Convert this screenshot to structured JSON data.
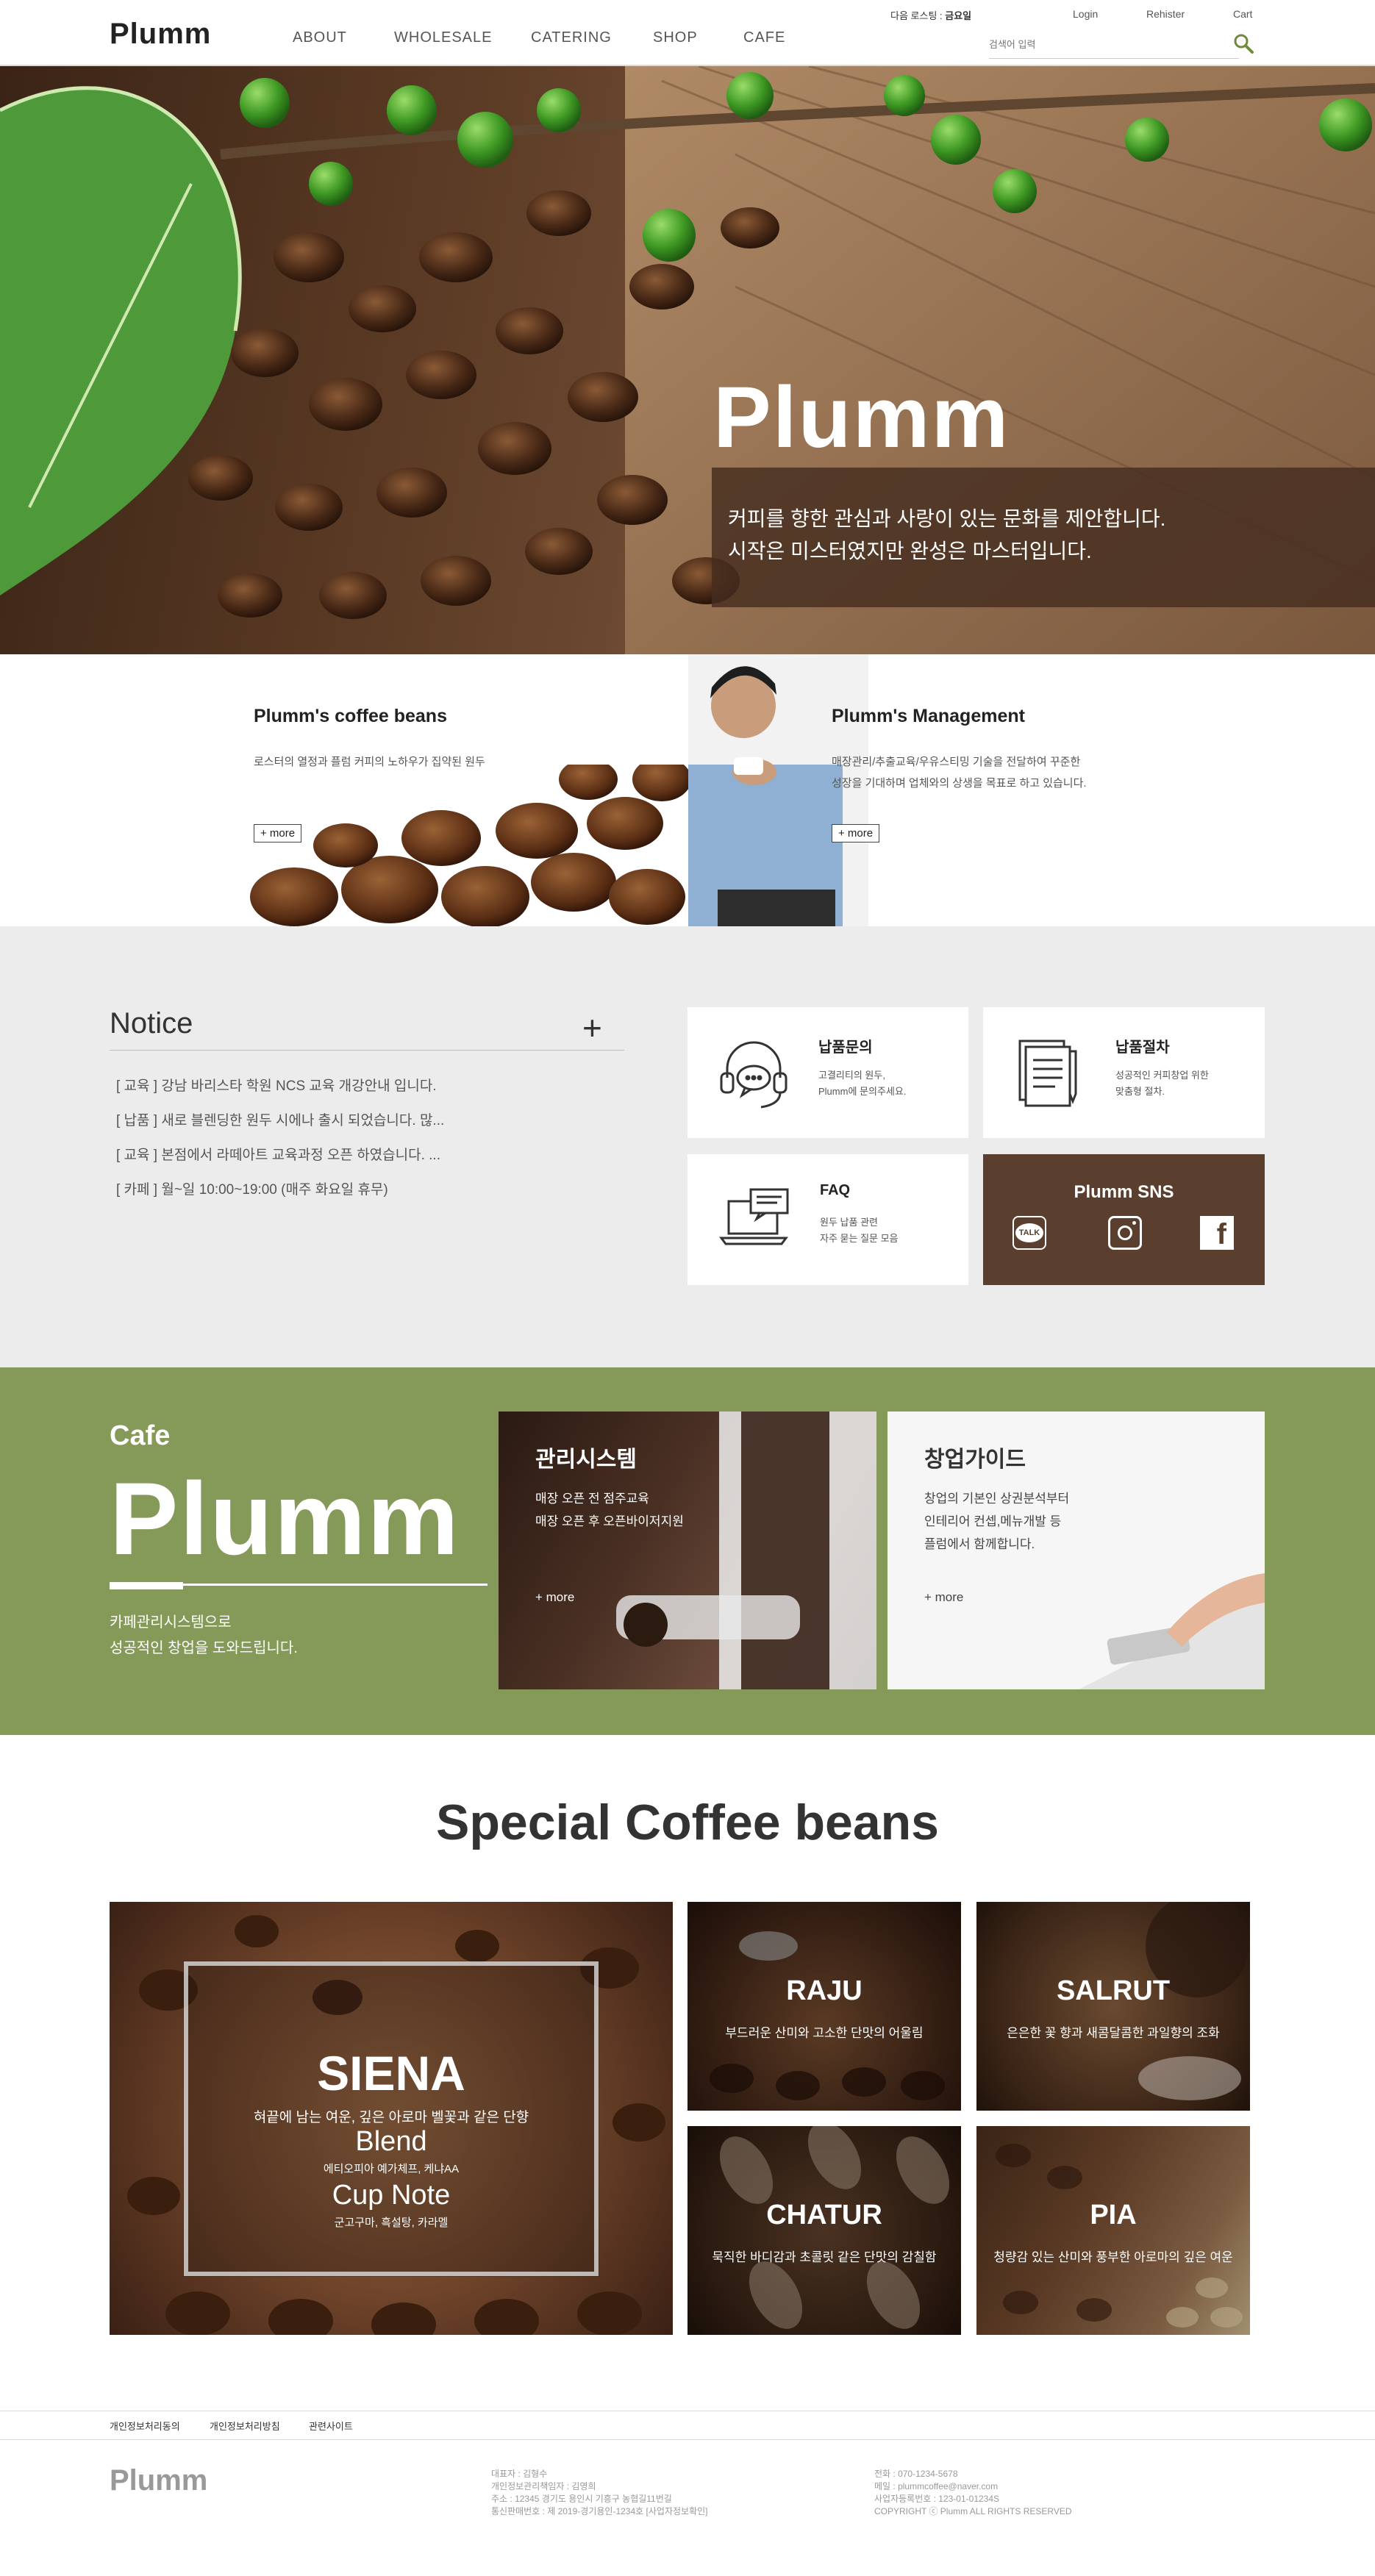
{
  "header": {
    "logo": "Plumm",
    "nav": [
      "ABOUT",
      "WHOLESALE",
      "CATERING",
      "SHOP",
      "CAFE"
    ],
    "roasting_label": "다음 로스팅 :",
    "roasting_day": "금요일",
    "login": "Login",
    "register": "Rehister",
    "cart": "Cart",
    "search_placeholder": "검색어 입력"
  },
  "hero": {
    "title": "Plumm",
    "line1": "커피를 향한 관심과 사랑이 있는 문화를 제안합니다.",
    "line2": "시작은 미스터였지만 완성은 마스터입니다."
  },
  "intro": {
    "beans": {
      "title": "Plumm's coffee beans",
      "text": "로스터의 열정과 플럼 커피의 노하우가 집약된 원두",
      "more": "+ more"
    },
    "management": {
      "title": "Plumm's Management",
      "text1": "매장관리/추출교육/우유스티밍 기술을 전달하여 꾸준한",
      "text2": "성장을 기대하며 업체와의 상생을 목표로 하고 있습니다.",
      "more": "+ more"
    }
  },
  "notice": {
    "title": "Notice",
    "plus": "+",
    "items": [
      "[ 교육 ] 강남 바리스타 학원 NCS 교육 개강안내 입니다.",
      "[ 납품 ] 새로 블렌딩한 원두 시에나 출시 되었습니다. 많...",
      "[ 교육 ] 본점에서 라떼아트 교육과정 오픈 하였습니다. ...",
      "[ 카페 ] 월~일 10:00~19:00 (매주 화요일 휴무)"
    ]
  },
  "cards": {
    "inquiry": {
      "title": "납품문의",
      "sub1": "고결리티의 원두,",
      "sub2": "Plumm에 문의주세요."
    },
    "process": {
      "title": "납품절차",
      "sub1": "성공적인 커피창업 위한",
      "sub2": "맞춤형 절차."
    },
    "faq": {
      "title": "FAQ",
      "sub1": "원두 납품 관련",
      "sub2": "자주 묻는 질문 모음"
    },
    "sns": {
      "title": "Plumm SNS",
      "talk": "TALK",
      "fb": "f"
    }
  },
  "cafe": {
    "small": "Cafe",
    "big": "Plumm",
    "desc1": "카페관리시스템으로",
    "desc2": "성공적인 창업을 도와드립니다.",
    "system": {
      "title": "관리시스템",
      "line1": "매장 오픈 전 점주교육",
      "line2": "매장 오픈 후 오픈바이저지원",
      "more": "+ more"
    },
    "guide": {
      "title": "창업가이드",
      "line1": "창업의 기본인 상권분석부터",
      "line2": "인테리어 컨셉,메뉴개발 등",
      "line3": "플럼에서 함께합니다.",
      "more": "+ more"
    }
  },
  "special": {
    "title": "Special Coffee beans",
    "siena": {
      "name": "SIENA",
      "desc": "혀끝에 남는 여운, 깊은 아로마 벨꽃과 같은 단향",
      "blend": "Blend",
      "blend_desc": "에티오피아 예가체프, 케냐AA",
      "cupnote": "Cup Note",
      "cupnote_desc": "군고구마, 흑설탕, 카라멜"
    },
    "raju": {
      "name": "RAJU",
      "desc": "부드러운 산미와 고소한 단맛의 어울림"
    },
    "salrut": {
      "name": "SALRUT",
      "desc": "은은한 꽃 향과 새콤달콤한 과일향의 조화"
    },
    "chatur": {
      "name": "CHATUR",
      "desc": "묵직한 바디감과 초콜릿 같은 단맛의 감칠함"
    },
    "pia": {
      "name": "PIA",
      "desc": "청량감 있는 산미와 풍부한 아로마의 깊은 여운"
    }
  },
  "footer": {
    "links": [
      "개인정보처리동의",
      "개인정보처리방침",
      "관련사이트"
    ],
    "logo": "Plumm",
    "col1": [
      "대표자 : 김형수",
      "개인정보관리책임자 : 김영희",
      "주소 : 12345 경기도 용인시 기흥구 농협길11번길",
      "통신판매번호 : 제 2019-경기용인-1234호 [사업자정보확인]"
    ],
    "col2": [
      "전화 : 070-1234-5678",
      "메일 : plummcoffee@naver.com",
      "사업자등록번호 : 123-01-01234S",
      "COPYRIGHT ⓒ Plumm ALL RIGHTS RESERVED"
    ]
  },
  "colors": {
    "olive": "#859a58",
    "sns_brown": "#5a3f2e",
    "info_bg": "#ececec"
  }
}
